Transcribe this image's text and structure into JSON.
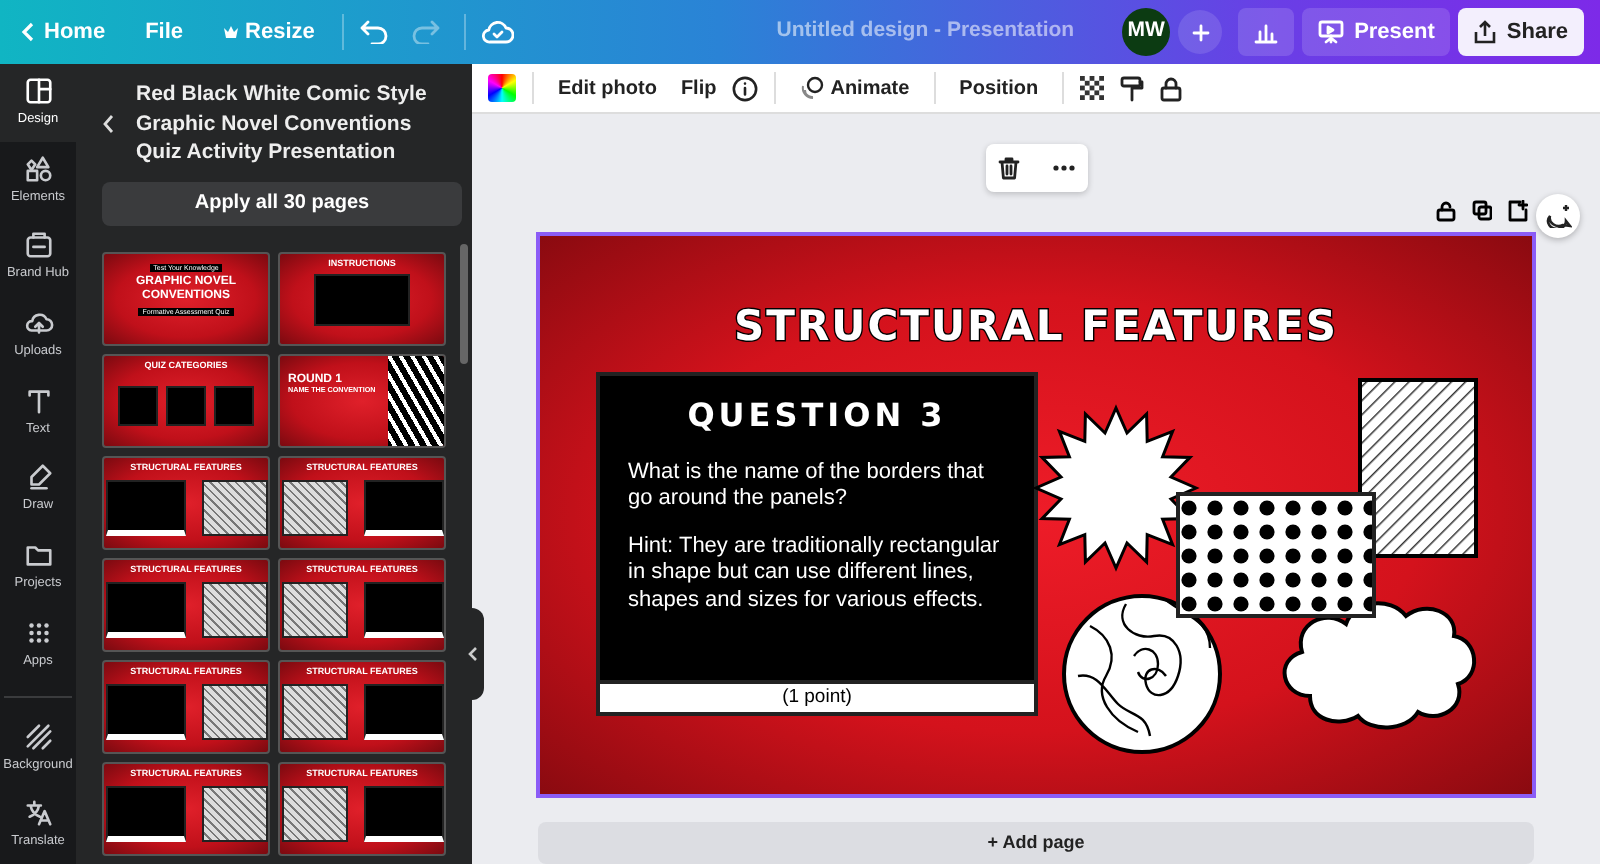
{
  "top_bar": {
    "nav": [
      "Home",
      "File",
      "Resize"
    ],
    "document_title": "Untitled design - Presentation",
    "avatar": "MW",
    "present": "Present",
    "share": "Share"
  },
  "sidebar": {
    "items": [
      {
        "label": "Design",
        "selected": true
      },
      {
        "label": "Elements",
        "selected": false
      },
      {
        "label": "Brand Hub",
        "selected": false
      },
      {
        "label": "Uploads",
        "selected": false
      },
      {
        "label": "Text",
        "selected": false
      },
      {
        "label": "Draw",
        "selected": false
      },
      {
        "label": "Projects",
        "selected": false
      },
      {
        "label": "Apps",
        "selected": false
      },
      {
        "label": "Background",
        "selected": false
      },
      {
        "label": "Translate",
        "selected": false
      }
    ]
  },
  "panel": {
    "title": "Red Black White Comic Style Graphic Novel Conventions Quiz Activity Presentation",
    "apply_button": "Apply all 30 pages",
    "thumbnails": [
      {
        "kind": "cover",
        "tag": "Test Your Knowledge",
        "title": "GRAPHIC NOVEL CONVENTIONS",
        "subtitle": "Formative Assessment Quiz"
      },
      {
        "kind": "text",
        "title": "INSTRUCTIONS"
      },
      {
        "kind": "categories",
        "title": "QUIZ CATEGORIES"
      },
      {
        "kind": "round",
        "title": "ROUND 1",
        "subtitle": "NAME THE CONVENTION"
      },
      {
        "kind": "box_left",
        "title": "STRUCTURAL FEATURES"
      },
      {
        "kind": "box_right",
        "title": "STRUCTURAL FEATURES"
      },
      {
        "kind": "box_left",
        "title": "STRUCTURAL FEATURES"
      },
      {
        "kind": "box_right",
        "title": "STRUCTURAL FEATURES"
      },
      {
        "kind": "box_left",
        "title": "STRUCTURAL FEATURES"
      },
      {
        "kind": "box_right",
        "title": "STRUCTURAL FEATURES"
      },
      {
        "kind": "box_left",
        "title": "STRUCTURAL FEATURES"
      },
      {
        "kind": "box_right",
        "title": "STRUCTURAL FEATURES"
      }
    ]
  },
  "toolbar": {
    "items": [
      "Edit photo",
      "Flip",
      "Animate",
      "Position"
    ]
  },
  "slide": {
    "title": "STRUCTURAL FEATURES",
    "heading": "QUESTION 3",
    "question": "What is the name of the borders that go around the panels?",
    "hint": "Hint: They are traditionally rectangular in shape but can use different lines, shapes and sizes for various effects.",
    "points": "(1 point)"
  },
  "add_page": "+ Add page"
}
